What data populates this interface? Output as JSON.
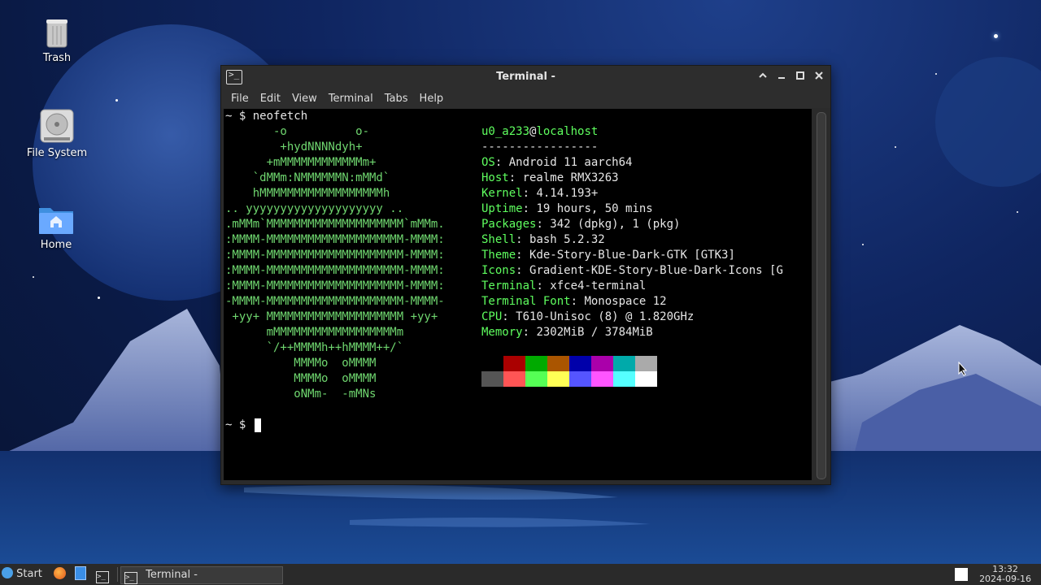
{
  "desktop": {
    "icons": [
      {
        "label": "Trash"
      },
      {
        "label": "File System"
      },
      {
        "label": "Home"
      }
    ]
  },
  "window": {
    "title": "Terminal -",
    "controls": {
      "up": "^",
      "minimize": "–",
      "maximize": "□",
      "close": "✕"
    }
  },
  "menu": [
    "File",
    "Edit",
    "View",
    "Terminal",
    "Tabs",
    "Help"
  ],
  "terminal": {
    "prompt": "~ $",
    "command": "neofetch",
    "logo": [
      "       -o          o-",
      "        +hydNNNNdyh+",
      "      +mMMMMMMMMMMMMm+",
      "    `dMMm:NMMMMMMN:mMMd`",
      "    hMMMMMMMMMMMMMMMMMMh",
      ".. yyyyyyyyyyyyyyyyyyyy ..",
      ".mMMm`MMMMMMMMMMMMMMMMMMMM`mMMm.",
      ":MMMM-MMMMMMMMMMMMMMMMMMMM-MMMM:",
      ":MMMM-MMMMMMMMMMMMMMMMMMMM-MMMM:",
      ":MMMM-MMMMMMMMMMMMMMMMMMMM-MMMM:",
      ":MMMM-MMMMMMMMMMMMMMMMMMMM-MMMM:",
      "-MMMM-MMMMMMMMMMMMMMMMMMMM-MMMM-",
      " +yy+ MMMMMMMMMMMMMMMMMMMM +yy+",
      "      mMMMMMMMMMMMMMMMMMMm",
      "      `/++MMMMh++hMMMM++/`",
      "          MMMMo  oMMMM",
      "          MMMMo  oMMMM",
      "          oNMm-  -mMNs"
    ],
    "user": "u0_a233",
    "at": "@",
    "host_name": "localhost",
    "separator": "-----------------",
    "info": [
      {
        "key": "OS",
        "value": "Android 11 aarch64"
      },
      {
        "key": "Host",
        "value": "realme RMX3263"
      },
      {
        "key": "Kernel",
        "value": "4.14.193+"
      },
      {
        "key": "Uptime",
        "value": "19 hours, 50 mins"
      },
      {
        "key": "Packages",
        "value": "342 (dpkg), 1 (pkg)"
      },
      {
        "key": "Shell",
        "value": "bash 5.2.32"
      },
      {
        "key": "Theme",
        "value": "Kde-Story-Blue-Dark-GTK [GTK3]"
      },
      {
        "key": "Icons",
        "value": "Gradient-KDE-Story-Blue-Dark-Icons [G"
      },
      {
        "key": "Terminal",
        "value": "xfce4-terminal"
      },
      {
        "key": "Terminal Font",
        "value": "Monospace 12"
      },
      {
        "key": "CPU",
        "value": "T610-Unisoc (8) @ 1.820GHz"
      },
      {
        "key": "Memory",
        "value": "2302MiB / 3784MiB"
      }
    ],
    "palette_top": [
      "#000000",
      "#aa0000",
      "#00aa00",
      "#aa5500",
      "#0000aa",
      "#aa00aa",
      "#00aaaa",
      "#aaaaaa"
    ],
    "palette_bottom": [
      "#555555",
      "#ff5555",
      "#55ff55",
      "#ffff55",
      "#5555ff",
      "#ff55ff",
      "#55ffff",
      "#ffffff"
    ],
    "prompt2": "~ $"
  },
  "taskbar": {
    "start_label": "Start",
    "active_task": "Terminal -",
    "time": "13:32",
    "date": "2024-09-16"
  },
  "colors": {
    "accent_green": "#5fff5f",
    "terminal_bg": "#000000",
    "titlebar_bg": "#2d2d2d",
    "taskbar_bg": "#2a2a2a"
  }
}
